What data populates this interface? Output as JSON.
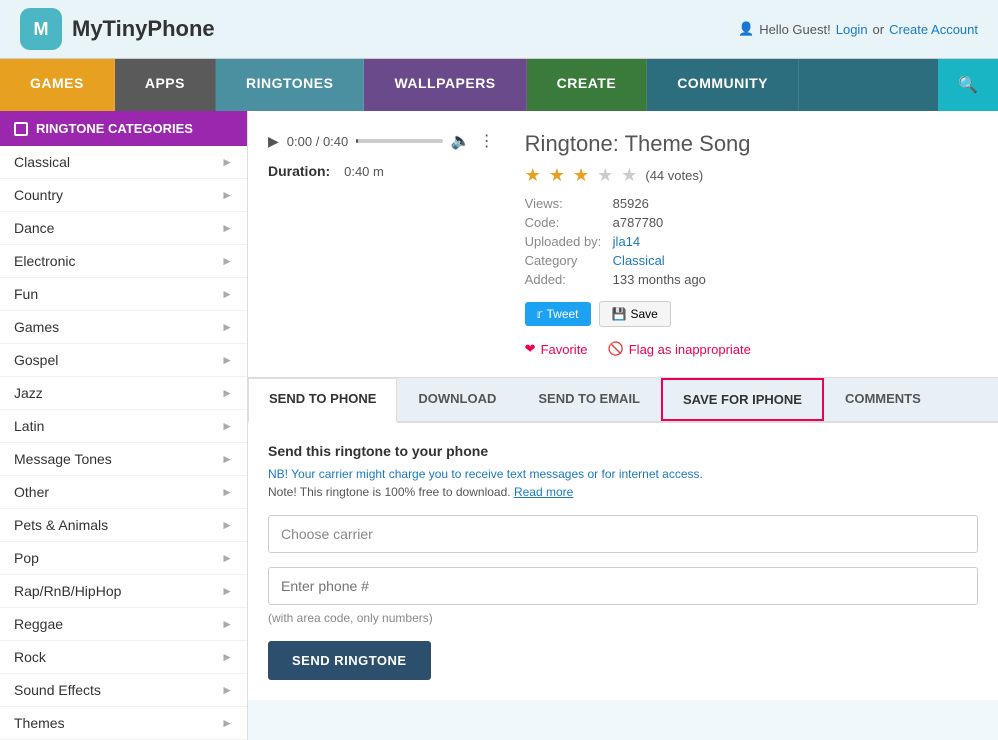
{
  "header": {
    "logo_letter": "M",
    "logo_text": "MyTinyPhone",
    "user_greeting": "Hello Guest!",
    "login_link": "Login",
    "or_text": "or",
    "create_account_link": "Create Account"
  },
  "nav": {
    "items": [
      {
        "label": "GAMES",
        "class": "games"
      },
      {
        "label": "APPS",
        "class": "apps"
      },
      {
        "label": "RINGTONES",
        "class": "ringtones"
      },
      {
        "label": "WALLPAPERS",
        "class": "wallpapers"
      },
      {
        "label": "CREATE",
        "class": "create"
      },
      {
        "label": "COMMUNITY",
        "class": "community"
      }
    ]
  },
  "sidebar": {
    "header": "RINGTONE CATEGORIES",
    "items": [
      {
        "label": "Classical"
      },
      {
        "label": "Country"
      },
      {
        "label": "Dance"
      },
      {
        "label": "Electronic"
      },
      {
        "label": "Fun"
      },
      {
        "label": "Games"
      },
      {
        "label": "Gospel"
      },
      {
        "label": "Jazz"
      },
      {
        "label": "Latin"
      },
      {
        "label": "Message Tones"
      },
      {
        "label": "Other"
      },
      {
        "label": "Pets & Animals"
      },
      {
        "label": "Pop"
      },
      {
        "label": "Rap/RnB/HipHop"
      },
      {
        "label": "Reggae"
      },
      {
        "label": "Rock"
      },
      {
        "label": "Sound Effects"
      },
      {
        "label": "Themes"
      }
    ]
  },
  "player": {
    "time_current": "0:00",
    "time_total": "0:40",
    "duration_label": "Duration:",
    "duration_value": "0:40 m"
  },
  "ringtone": {
    "title": "Ringtone: Theme Song",
    "stars_filled": 2,
    "stars_half": 1,
    "stars_empty": 2,
    "votes": "(44 votes)",
    "views_label": "Views:",
    "views_value": "85926",
    "code_label": "Code:",
    "code_value": "a787780",
    "uploaded_label": "Uploaded by:",
    "uploaded_value": "jla14",
    "category_label": "Category",
    "category_value": "Classical",
    "added_label": "Added:",
    "added_value": "133 months ago",
    "tweet_label": "Tweet",
    "save_label": "Save",
    "favorite_label": "Favorite",
    "flag_label": "Flag as inappropriate"
  },
  "tabs": [
    {
      "label": "SEND TO PHONE",
      "id": "send-to-phone",
      "active": true
    },
    {
      "label": "DOWNLOAD",
      "id": "download"
    },
    {
      "label": "SEND TO EMAIL",
      "id": "send-to-email"
    },
    {
      "label": "SAVE FOR IPHONE",
      "id": "save-for-iphone",
      "highlighted": true
    },
    {
      "label": "COMMENTS",
      "id": "comments"
    }
  ],
  "send_tab": {
    "title": "Send this ringtone to your phone",
    "nb_text": "NB! Your carrier might charge you to receive text messages or for internet access.",
    "note_text": "Note! This ringtone is 100% free to download.",
    "read_more": "Read more",
    "carrier_placeholder": "Choose carrier",
    "phone_placeholder": "Enter phone #",
    "area_code_note": "(with area code, only numbers)",
    "send_button": "SEND RINGTONE"
  }
}
